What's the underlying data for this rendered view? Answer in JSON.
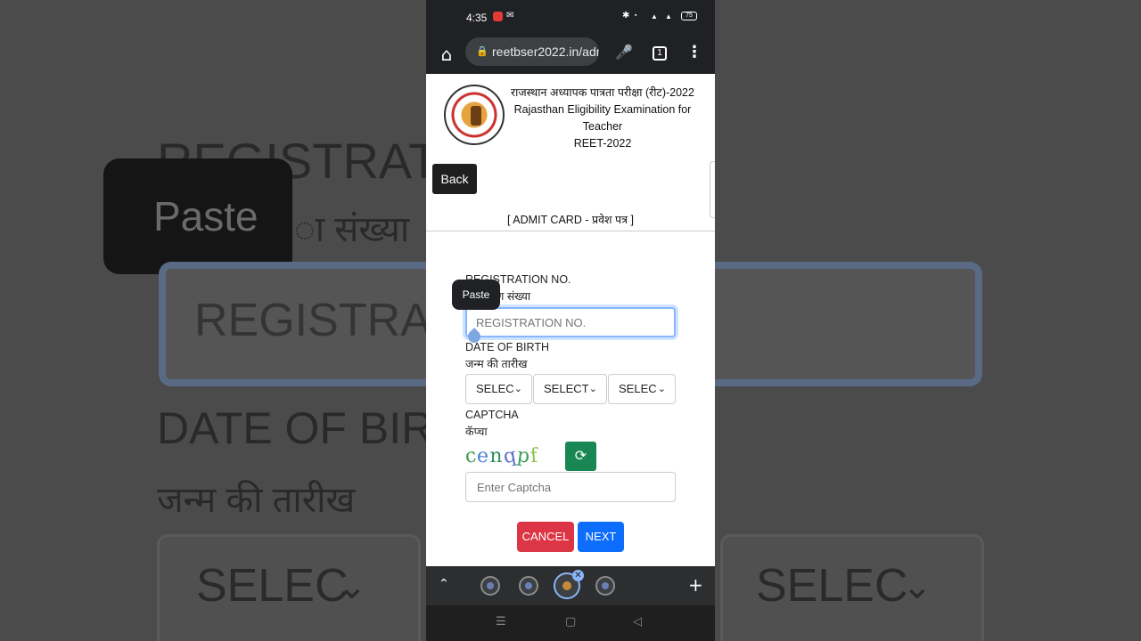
{
  "status_bar": {
    "time": "4:35",
    "battery": "75"
  },
  "browser": {
    "url": "reetbser2022.in/adr",
    "tab_count": "1"
  },
  "header": {
    "line1": "राजस्थान अध्यापक पात्रता परीक्षा (रीट)-2022",
    "line2": "Rajasthan Eligibility Examination for Teacher",
    "line3": "REET-2022"
  },
  "back_label": "Back",
  "section_title": "[ ADMIT CARD - प्रवेश पत्र ]",
  "paste_label": "Paste",
  "form": {
    "reg_label_en": "REGISTRATION NO.",
    "reg_label_hi": "पंजीकरण संख्या",
    "reg_placeholder": "REGISTRATION NO.",
    "dob_label_en": "DATE OF BIRTH",
    "dob_label_hi": "जन्म की तारीख",
    "dob_day": "SELEC",
    "dob_month": "SELECT",
    "dob_year": "SELEC",
    "captcha_label_en": "CAPTCHA",
    "captcha_label_hi": "कॅप्चा",
    "captcha_text": "cenqpf",
    "captcha_placeholder": "Enter Captcha",
    "cancel_label": "CANCEL",
    "next_label": "NEXT"
  },
  "background": {
    "left_reg": "REGISTRATION N",
    "left_paste": "Paste",
    "left_hi": "ा संख्या",
    "left_input": "REGISTRATIO",
    "left_dob": "DATE OF BIRTH",
    "left_dob_hi": "जन्म की तारीख",
    "left_select": "SELEC",
    "right_select": "SELEC"
  },
  "colors": {
    "cancel": "#dc3545",
    "next": "#0d6efd",
    "refresh": "#198754",
    "focus": "#86b7fe"
  }
}
